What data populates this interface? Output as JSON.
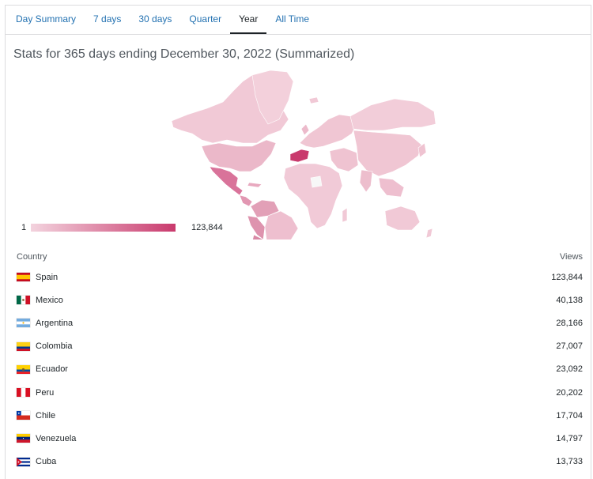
{
  "tabs": [
    {
      "label": "Day Summary",
      "active": false
    },
    {
      "label": "7 days",
      "active": false
    },
    {
      "label": "30 days",
      "active": false
    },
    {
      "label": "Quarter",
      "active": false
    },
    {
      "label": "Year",
      "active": true
    },
    {
      "label": "All Time",
      "active": false
    }
  ],
  "title": "Stats for 365 days ending December 30, 2022 (Summarized)",
  "legend": {
    "min": "1",
    "max": "123,844",
    "color_low": "#f3d3de",
    "color_high": "#c93a6d"
  },
  "table": {
    "header_country": "Country",
    "header_views": "Views",
    "rows": [
      {
        "country": "Spain",
        "views": "123,844",
        "flag": "spain-flag-icon"
      },
      {
        "country": "Mexico",
        "views": "40,138",
        "flag": "mexico-flag-icon"
      },
      {
        "country": "Argentina",
        "views": "28,166",
        "flag": "argentina-flag-icon"
      },
      {
        "country": "Colombia",
        "views": "27,007",
        "flag": "colombia-flag-icon"
      },
      {
        "country": "Ecuador",
        "views": "23,092",
        "flag": "ecuador-flag-icon"
      },
      {
        "country": "Peru",
        "views": "20,202",
        "flag": "peru-flag-icon"
      },
      {
        "country": "Chile",
        "views": "17,704",
        "flag": "chile-flag-icon"
      },
      {
        "country": "Venezuela",
        "views": "14,797",
        "flag": "venezuela-flag-icon"
      },
      {
        "country": "Cuba",
        "views": "13,733",
        "flag": "cuba-flag-icon"
      }
    ]
  }
}
